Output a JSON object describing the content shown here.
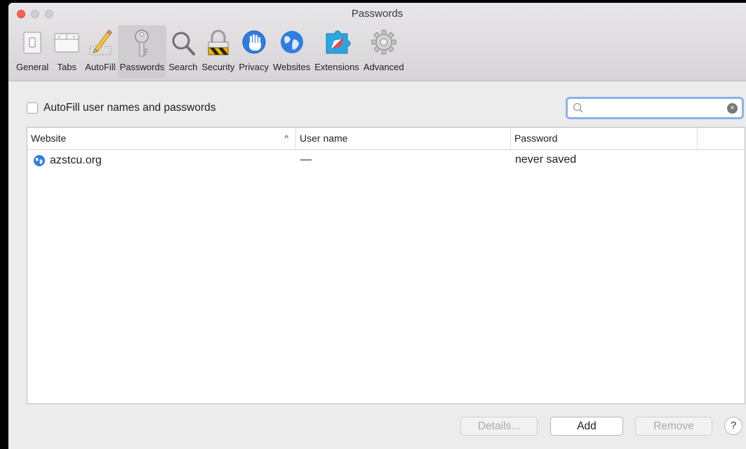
{
  "window": {
    "title": "Passwords"
  },
  "toolbar": {
    "items": [
      {
        "label": "General",
        "icon": "general-switch-icon"
      },
      {
        "label": "Tabs",
        "icon": "tabs-icon"
      },
      {
        "label": "AutoFill",
        "icon": "pencil-icon"
      },
      {
        "label": "Passwords",
        "icon": "key-icon",
        "selected": true
      },
      {
        "label": "Search",
        "icon": "magnifier-icon"
      },
      {
        "label": "Security",
        "icon": "lock-icon"
      },
      {
        "label": "Privacy",
        "icon": "hand-icon"
      },
      {
        "label": "Websites",
        "icon": "globe-icon"
      },
      {
        "label": "Extensions",
        "icon": "puzzle-icon"
      },
      {
        "label": "Advanced",
        "icon": "gear-icon"
      }
    ]
  },
  "autofill": {
    "label": "AutoFill user names and passwords",
    "checked": false
  },
  "search": {
    "placeholder": "",
    "value": ""
  },
  "table": {
    "columns": [
      "Website",
      "User name",
      "Password"
    ],
    "sort_indicator": "^",
    "rows": [
      {
        "website": "azstcu.org",
        "username": "—",
        "password": "never saved"
      }
    ]
  },
  "buttons": {
    "details": "Details...",
    "add": "Add",
    "remove": "Remove",
    "help": "?"
  },
  "colors": {
    "selected_tab_bg": "#cfcdcf",
    "search_focus_ring": "#8ab3e6",
    "close_button": "#fd5f57"
  }
}
